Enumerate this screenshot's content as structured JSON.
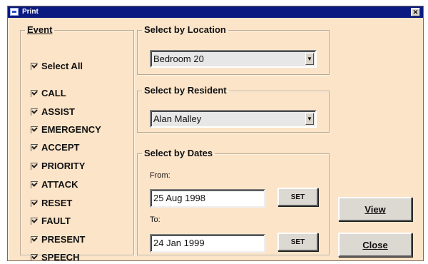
{
  "window": {
    "title": "Print",
    "close_glyph": "✕"
  },
  "event_group": {
    "legend": "Event",
    "items": [
      {
        "label": "Select All",
        "checked": true
      },
      {
        "label": "CALL",
        "checked": true
      },
      {
        "label": "ASSIST",
        "checked": true
      },
      {
        "label": "EMERGENCY",
        "checked": true
      },
      {
        "label": "ACCEPT",
        "checked": true
      },
      {
        "label": "PRIORITY",
        "checked": true
      },
      {
        "label": "ATTACK",
        "checked": true
      },
      {
        "label": "RESET",
        "checked": true
      },
      {
        "label": "FAULT",
        "checked": true
      },
      {
        "label": "PRESENT",
        "checked": true
      },
      {
        "label": "SPEECH",
        "checked": true
      }
    ]
  },
  "location": {
    "legend": "Select by Location",
    "value": "Bedroom 20"
  },
  "resident": {
    "legend": "Select by Resident",
    "value": "Alan Malley"
  },
  "dates": {
    "legend": "Select by Dates",
    "from_label": "From:",
    "from_value": "25 Aug 1998",
    "to_label": "To:",
    "to_value": "24 Jan 1999",
    "set_label": "SET"
  },
  "buttons": {
    "view": "View",
    "close": "Close"
  },
  "icons": {
    "dropdown": "chevron-down-icon",
    "checkbox": "checkmark-icon",
    "app": "window-icon"
  },
  "colors": {
    "titlebar": "#0a1a80",
    "window_bg": "#fce4c8"
  }
}
